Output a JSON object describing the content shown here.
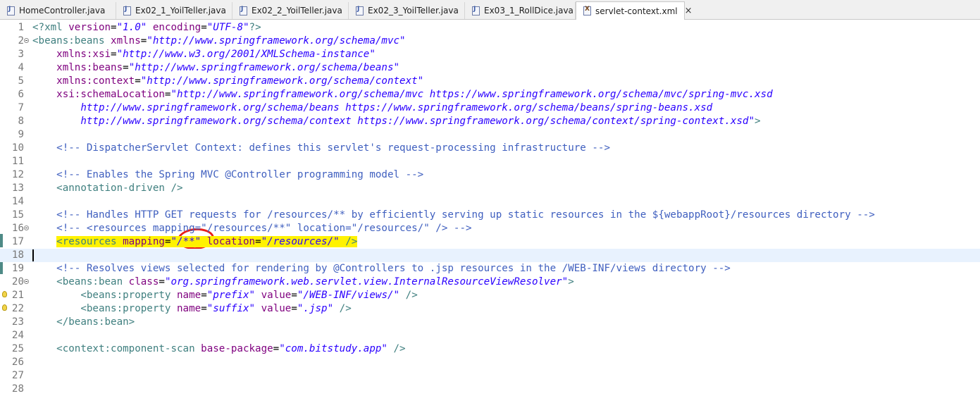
{
  "tabs": [
    {
      "label": "HomeController.java",
      "active": false,
      "icon": "java-file-icon"
    },
    {
      "label": "Ex02_1_YoilTeller.java",
      "active": false,
      "icon": "java-file-icon"
    },
    {
      "label": "Ex02_2_YoilTeller.java",
      "active": false,
      "icon": "java-file-icon"
    },
    {
      "label": "Ex02_3_YoilTeller.java",
      "active": false,
      "icon": "java-file-icon"
    },
    {
      "label": "Ex03_1_RollDice.java",
      "active": false,
      "icon": "java-file-icon"
    },
    {
      "label": "servlet-context.xml",
      "active": true,
      "icon": "xml-file-icon",
      "close": "×"
    }
  ],
  "editor": {
    "current_line": 18,
    "highlighted_line": 17,
    "colors": {
      "tag": "#3f7f7f",
      "attribute": "#7f007f",
      "value": "#2a00ff",
      "comment": "#3f5fbf",
      "highlight": "#fff200",
      "annotation_circle": "#e8201c"
    },
    "lines": [
      {
        "n": "1",
        "fold": false,
        "bulb": false,
        "tokens": [
          [
            "pi",
            "<?xml "
          ],
          [
            "attr",
            "version"
          ],
          [
            "txt",
            "="
          ],
          [
            "val",
            "\"1.0\""
          ],
          [
            "txt",
            " "
          ],
          [
            "attr",
            "encoding"
          ],
          [
            "txt",
            "="
          ],
          [
            "val",
            "\"UTF-8\""
          ],
          [
            "pi",
            "?>"
          ]
        ]
      },
      {
        "n": "2",
        "fold": true,
        "bulb": false,
        "tokens": [
          [
            "tag",
            "<beans:beans "
          ],
          [
            "attr",
            "xmlns"
          ],
          [
            "txt",
            "="
          ],
          [
            "val",
            "\"http://www.springframework.org/schema/mvc\""
          ]
        ]
      },
      {
        "n": "3",
        "fold": false,
        "bulb": false,
        "tokens": [
          [
            "txt",
            "    "
          ],
          [
            "attr",
            "xmlns:xsi"
          ],
          [
            "txt",
            "="
          ],
          [
            "val",
            "\"http://www.w3.org/2001/XMLSchema-instance\""
          ]
        ]
      },
      {
        "n": "4",
        "fold": false,
        "bulb": false,
        "tokens": [
          [
            "txt",
            "    "
          ],
          [
            "attr",
            "xmlns:beans"
          ],
          [
            "txt",
            "="
          ],
          [
            "val",
            "\"http://www.springframework.org/schema/beans\""
          ]
        ]
      },
      {
        "n": "5",
        "fold": false,
        "bulb": false,
        "tokens": [
          [
            "txt",
            "    "
          ],
          [
            "attr",
            "xmlns:context"
          ],
          [
            "txt",
            "="
          ],
          [
            "val",
            "\"http://www.springframework.org/schema/context\""
          ]
        ]
      },
      {
        "n": "6",
        "fold": false,
        "bulb": false,
        "tokens": [
          [
            "txt",
            "    "
          ],
          [
            "attr",
            "xsi:schemaLocation"
          ],
          [
            "txt",
            "="
          ],
          [
            "val",
            "\"http://www.springframework.org/schema/mvc https://www.springframework.org/schema/mvc/spring-mvc.xsd"
          ]
        ]
      },
      {
        "n": "7",
        "fold": false,
        "bulb": false,
        "tokens": [
          [
            "val",
            "        http://www.springframework.org/schema/beans https://www.springframework.org/schema/beans/spring-beans.xsd"
          ]
        ]
      },
      {
        "n": "8",
        "fold": false,
        "bulb": false,
        "tokens": [
          [
            "val",
            "        http://www.springframework.org/schema/context https://www.springframework.org/schema/context/spring-context.xsd\""
          ],
          [
            "tag",
            ">"
          ]
        ]
      },
      {
        "n": "9",
        "fold": false,
        "bulb": false,
        "tokens": []
      },
      {
        "n": "10",
        "fold": false,
        "bulb": false,
        "tokens": [
          [
            "txt",
            "    "
          ],
          [
            "com",
            "<!-- DispatcherServlet Context: defines this servlet's request-processing infrastructure -->"
          ]
        ]
      },
      {
        "n": "11",
        "fold": false,
        "bulb": false,
        "tokens": []
      },
      {
        "n": "12",
        "fold": false,
        "bulb": false,
        "tokens": [
          [
            "txt",
            "    "
          ],
          [
            "com",
            "<!-- Enables the Spring MVC @Controller programming model -->"
          ]
        ]
      },
      {
        "n": "13",
        "fold": false,
        "bulb": false,
        "tokens": [
          [
            "txt",
            "    "
          ],
          [
            "tag",
            "<annotation-driven />"
          ]
        ]
      },
      {
        "n": "14",
        "fold": false,
        "bulb": false,
        "tokens": []
      },
      {
        "n": "15",
        "fold": false,
        "bulb": false,
        "tokens": [
          [
            "txt",
            "    "
          ],
          [
            "com",
            "<!-- Handles HTTP GET requests for /resources/** by efficiently serving up static resources in the ${webappRoot}/resources directory -->"
          ]
        ]
      },
      {
        "n": "16",
        "fold": true,
        "bulb": false,
        "tokens": [
          [
            "txt",
            "    "
          ],
          [
            "com",
            "<!-- <resources mapping=\"/resources/**\" location=\"/resources/\" /> -->"
          ]
        ]
      },
      {
        "n": "17",
        "fold": false,
        "bulb": false,
        "tokens": [
          [
            "txt",
            "    "
          ],
          [
            "tag-hl",
            "<resources "
          ],
          [
            "attr-hl",
            "mapping"
          ],
          [
            "txt-hl",
            "="
          ],
          [
            "val-hl",
            "\"/**\""
          ],
          [
            "txt-hl",
            " "
          ],
          [
            "attr-hl",
            "location"
          ],
          [
            "txt-hl",
            "="
          ],
          [
            "val-hl",
            "\"/resources/\""
          ],
          [
            "tag-hl",
            " />"
          ]
        ]
      },
      {
        "n": "18",
        "fold": false,
        "bulb": false,
        "tokens": []
      },
      {
        "n": "19",
        "fold": false,
        "bulb": false,
        "tokens": [
          [
            "txt",
            "    "
          ],
          [
            "com",
            "<!-- Resolves views selected for rendering by @Controllers to .jsp resources in the /WEB-INF/views directory -->"
          ]
        ]
      },
      {
        "n": "20",
        "fold": true,
        "bulb": false,
        "tokens": [
          [
            "txt",
            "    "
          ],
          [
            "tag",
            "<beans:bean "
          ],
          [
            "attr",
            "class"
          ],
          [
            "txt",
            "="
          ],
          [
            "val",
            "\"org.springframework.web.servlet.view.InternalResourceViewResolver\""
          ],
          [
            "tag",
            ">"
          ]
        ]
      },
      {
        "n": "21",
        "fold": false,
        "bulb": true,
        "tokens": [
          [
            "txt",
            "        "
          ],
          [
            "tag",
            "<beans:property "
          ],
          [
            "attr",
            "name"
          ],
          [
            "txt",
            "="
          ],
          [
            "val",
            "\"prefix\""
          ],
          [
            "txt",
            " "
          ],
          [
            "attr",
            "value"
          ],
          [
            "txt",
            "="
          ],
          [
            "val",
            "\"/WEB-INF/views/\""
          ],
          [
            "tag",
            " />"
          ]
        ]
      },
      {
        "n": "22",
        "fold": false,
        "bulb": true,
        "tokens": [
          [
            "txt",
            "        "
          ],
          [
            "tag",
            "<beans:property "
          ],
          [
            "attr",
            "name"
          ],
          [
            "txt",
            "="
          ],
          [
            "val",
            "\"suffix\""
          ],
          [
            "txt",
            " "
          ],
          [
            "attr",
            "value"
          ],
          [
            "txt",
            "="
          ],
          [
            "val",
            "\".jsp\""
          ],
          [
            "tag",
            " />"
          ]
        ]
      },
      {
        "n": "23",
        "fold": false,
        "bulb": false,
        "tokens": [
          [
            "txt",
            "    "
          ],
          [
            "tag",
            "</beans:bean>"
          ]
        ]
      },
      {
        "n": "24",
        "fold": false,
        "bulb": false,
        "tokens": []
      },
      {
        "n": "25",
        "fold": false,
        "bulb": false,
        "tokens": [
          [
            "txt",
            "    "
          ],
          [
            "tag",
            "<context:component-scan "
          ],
          [
            "attr",
            "base-package"
          ],
          [
            "txt",
            "="
          ],
          [
            "val",
            "\"com.bitstudy.app\""
          ],
          [
            "tag",
            " />"
          ]
        ]
      },
      {
        "n": "26",
        "fold": false,
        "bulb": false,
        "tokens": []
      },
      {
        "n": "27",
        "fold": false,
        "bulb": false,
        "tokens": []
      },
      {
        "n": "28",
        "fold": false,
        "bulb": false,
        "tokens": []
      }
    ]
  }
}
